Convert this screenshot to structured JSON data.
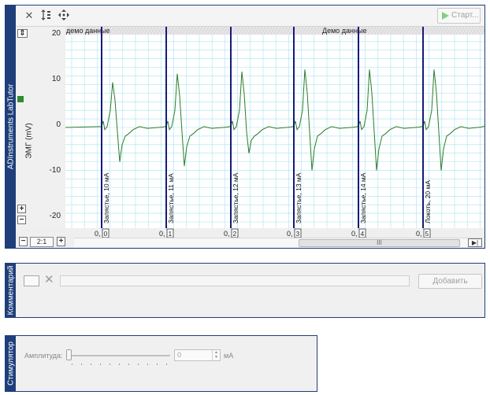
{
  "app": {
    "vendor_title": "ADInstruments LabTutor"
  },
  "toolbar": {
    "start_label": "Старт...",
    "icons": [
      "close-icon",
      "autoscale-icon",
      "move-icon"
    ]
  },
  "chart": {
    "channel_label": "ЭМГ (mV)",
    "channel_color": "#2e8b2e",
    "y_ticks": [
      "20",
      "10",
      "0",
      "-10",
      "-20"
    ],
    "demo_labels": [
      "демо данные",
      "Демо данные"
    ],
    "zoom_label": "2:1",
    "time_labels": [
      "0,",
      "0,",
      "0,",
      "0,",
      "0,",
      "0,"
    ],
    "block_numbers": [
      "0",
      "1",
      "2",
      "3",
      "4",
      "5"
    ],
    "scroll_grip": "III"
  },
  "chart_data": {
    "type": "line",
    "ylabel": "ЭМГ (mV)",
    "ylim": [
      -22,
      22
    ],
    "grid": true,
    "series": [
      {
        "color": "#2b7d2b",
        "blocks": [
          {
            "peak": 10.5,
            "trough": -8.0
          },
          {
            "peak": 12.5,
            "trough": -9.0
          },
          {
            "peak": 13.0,
            "trough": -6.0
          },
          {
            "peak": 13.5,
            "trough": -10.0
          },
          {
            "peak": 13.5,
            "trough": -10.0
          },
          {
            "peak": 13.5,
            "trough": -10.0
          }
        ]
      }
    ],
    "comment_markers": [
      "Запястье, 10 мА",
      "Запястье, 11 мА",
      "Запястье, 12 мА",
      "Запястье, 13 мА",
      "Запястье, 14 мА",
      "Локоть, 20 мА"
    ]
  },
  "comments": {
    "panel_title": "Комментарий",
    "add_label": "Добавить",
    "input_value": ""
  },
  "stimulator": {
    "panel_title": "Стимулятор",
    "amplitude_label": "Амплитуда:",
    "amplitude_value": "0",
    "unit": "мА",
    "slider_value": 0
  }
}
